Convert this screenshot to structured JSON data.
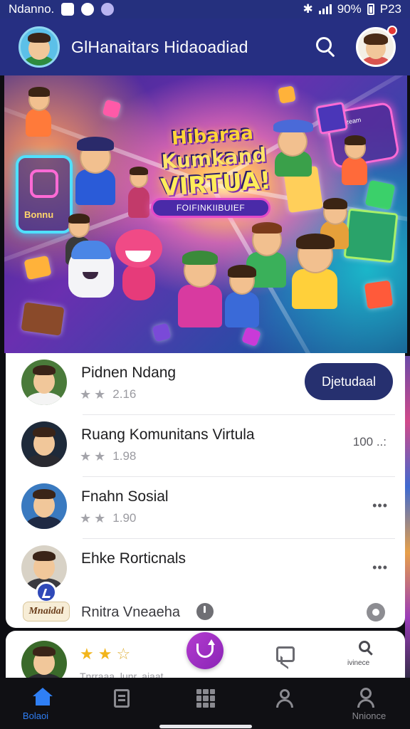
{
  "status_bar": {
    "carrier": "Ndanno.",
    "battery": "90%",
    "time": "P23"
  },
  "header": {
    "title": "GlHanaitars Hidaoadiad",
    "icons": [
      "avatar",
      "search-icon",
      "profile-avatar"
    ],
    "notification_color": "#e53935"
  },
  "hero": {
    "line1": "Hibaraa",
    "line2": "Kumkand",
    "line3": "VIRTUA!",
    "pill": "FOIFINKIIBUIEF",
    "left_panel_text": "Bonnu",
    "right_panel_text": "Kobzeam"
  },
  "list": [
    {
      "name": "Pidnen Ndang",
      "rating": "2.16",
      "action": "Djetudaal"
    },
    {
      "name": "Ruang Komunitans Virtula",
      "rating": "1.98",
      "more": "100 ..:"
    },
    {
      "name": "Fnahn Sosial",
      "rating": "1.90",
      "more": "•••"
    },
    {
      "name": "Ehke Rorticnals",
      "more": "•••",
      "tag": "Mnaidal",
      "subtitle": "Rnitra Vneaeha"
    }
  ],
  "card2": {
    "stars_filled": 2,
    "stars_total": 3,
    "search_label": "ivinece",
    "subtitle": "Tnrraaa..lunr..aiaat"
  },
  "bottom_nav": {
    "items": [
      {
        "label": "Bolaoi",
        "icon": "home-icon",
        "active": true
      },
      {
        "label": "",
        "icon": "document-icon",
        "active": false
      },
      {
        "label": "",
        "icon": "grid-icon",
        "active": false
      },
      {
        "label": "",
        "icon": "people-icon",
        "active": false
      },
      {
        "label": "Nnionce",
        "icon": "profile-icon",
        "active": false
      }
    ]
  },
  "colors": {
    "header": "#262f82",
    "primary_button": "#26306f",
    "nav_active": "#2f7ff5",
    "fab": "#a330c4"
  }
}
